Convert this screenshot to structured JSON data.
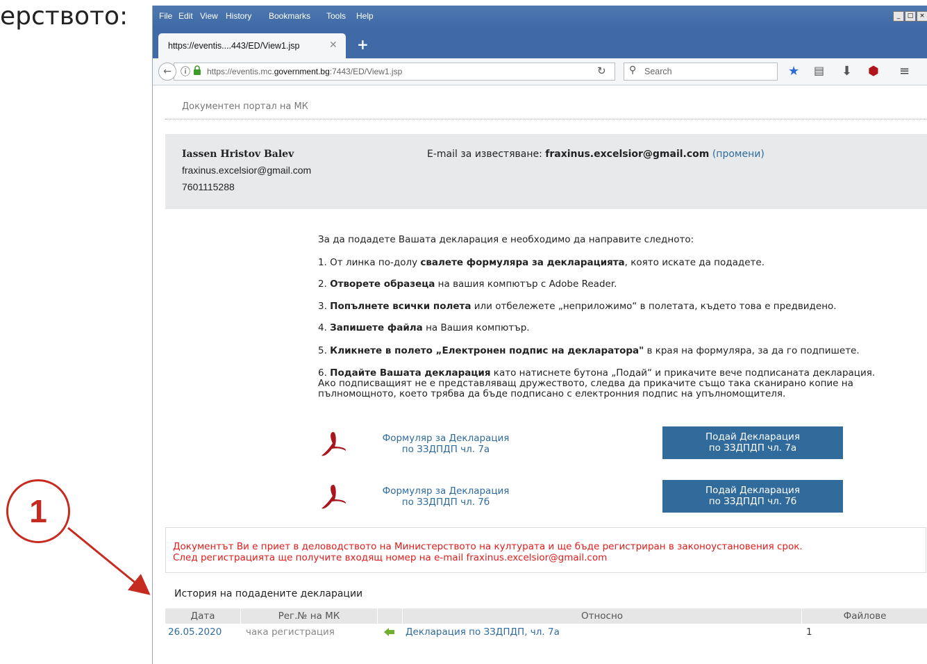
{
  "slide": {
    "text_fragment": "ерството:",
    "callout_number": "1"
  },
  "browser": {
    "menu": [
      "File",
      "Edit",
      "View",
      "History",
      "Bookmarks",
      "Tools",
      "Help"
    ],
    "tab_title": "https://eventis....443/ED/View1.jsp",
    "url_prefix": "https://eventis.mc.",
    "url_domain": "government.bg",
    "url_suffix": ":7443/ED/View1.jsp",
    "search_placeholder": "Search"
  },
  "page": {
    "portal_title": "Документен портал на МК",
    "user": {
      "name": "Iassen Hristov Balev",
      "email": "fraxinus.excelsior@gmail.com",
      "id": "7601115288"
    },
    "notify": {
      "label": "E-mail за известяване:",
      "email": "fraxinus.excelsior@gmail.com",
      "change_link": "(промени)"
    },
    "instructions": {
      "intro": "За да подадете Вашата декларация е необходимо да направите следното:",
      "s1_pre": "1. От линка по-долу ",
      "s1_bold": "свалете формуляра за декларацията",
      "s1_post": ", която искате да подадете.",
      "s2_pre": "2. ",
      "s2_bold": "Отворете образеца",
      "s2_post": " на вашия компютър с Adobe Reader.",
      "s3_pre": "3. ",
      "s3_bold": "Попълнете всички полета",
      "s3_post": " или отбележете „неприложимо“ в полетата, където това е предвидено.",
      "s4_pre": "4. ",
      "s4_bold": "Запишете файла",
      "s4_post": " на Вашия компютър.",
      "s5_pre": "5. ",
      "s5_bold": "Кликнете в полето „Електронен подпис на декларатора\"",
      "s5_post": " в края на формуляра, за да го подпишете.",
      "s6_pre": "6. ",
      "s6_bold": "Подайте Вашата декларация",
      "s6_post": " като натиснете бутона „Подай“ и прикачите вече подписаната декларация. Ако подписващият не е представляващ дружеството, следва да прикачите също така сканирано копие на пълномощното, което трябва да бъде подписано с електронния подпис на упълномощителя."
    },
    "forms": [
      {
        "link_line1": "Формуляр за Декларация",
        "link_line2": "по ЗЗДПДП чл. 7а",
        "button_line1": "Подай Декларация",
        "button_line2": "по ЗЗДПДП чл. 7а"
      },
      {
        "link_line1": "Формуляр за Декларация",
        "link_line2": "по ЗЗДПДП чл. 7б",
        "button_line1": "Подай Декларация",
        "button_line2": "по ЗЗДПДП чл. 7б"
      }
    ],
    "notice_line1": "Документът Ви е приет в деловодството на Министерството на културата и ще бъде регистриран в законоустановения срок.",
    "notice_line2": "След регистрацията ще получите входящ номер на e-mail fraxinus.excelsior@gmail.com",
    "history": {
      "title": "История на подадените декларации",
      "columns": [
        "Дата",
        "Рег.№ на МК",
        "",
        "Относно",
        "Файлове"
      ],
      "rows": [
        {
          "date": "26.05.2020",
          "reg": "чака регистрация",
          "subject": "Декларация по ЗЗДПДП, чл. 7а",
          "files": "1"
        }
      ]
    }
  },
  "colors": {
    "accent": "#316b9b",
    "link": "#2f6b9d",
    "notice": "#e21b1b",
    "callout": "#c62b21"
  }
}
